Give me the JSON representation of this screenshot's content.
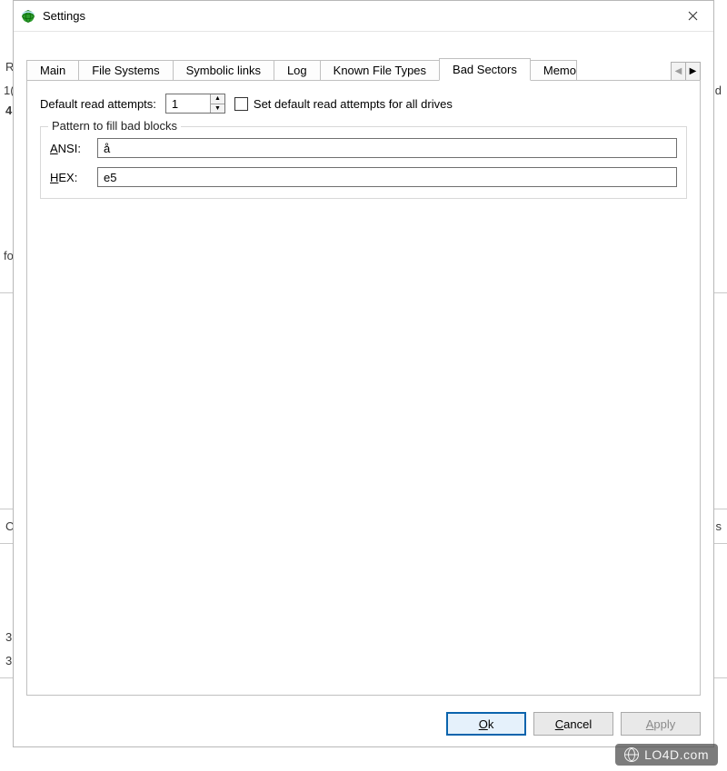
{
  "window": {
    "title": "Settings"
  },
  "tabs": {
    "items": [
      {
        "label": "Main"
      },
      {
        "label": "File Systems"
      },
      {
        "label": "Symbolic links"
      },
      {
        "label": "Log"
      },
      {
        "label": "Known File Types"
      },
      {
        "label": "Bad Sectors"
      },
      {
        "label": "Memo"
      }
    ],
    "activeIndex": 5
  },
  "badSectors": {
    "readAttemptsLabel": "Default read attempts:",
    "readAttemptsValue": "1",
    "setForAllLabel": "Set default read attempts for all drives",
    "setForAllChecked": false,
    "groupTitle": "Pattern to fill bad blocks",
    "ansiPrefix": "A",
    "ansiRest": "NSI:",
    "ansiValue": "å",
    "hexPrefix": "H",
    "hexRest": "EX:",
    "hexValue": "e5"
  },
  "buttons": {
    "okPrefix": "O",
    "okRest": "k",
    "cancelPrefix": "C",
    "cancelRest": "ancel",
    "applyPrefix": "A",
    "applyRest": "pply"
  },
  "watermark": "LO4D.com",
  "bgHints": {
    "left1": "R",
    "left2": "1(",
    "left3": "4",
    "left4": "fo",
    "left5": "C",
    "left6": "3",
    "left7": "3",
    "right1": "d",
    "right2": "s"
  }
}
